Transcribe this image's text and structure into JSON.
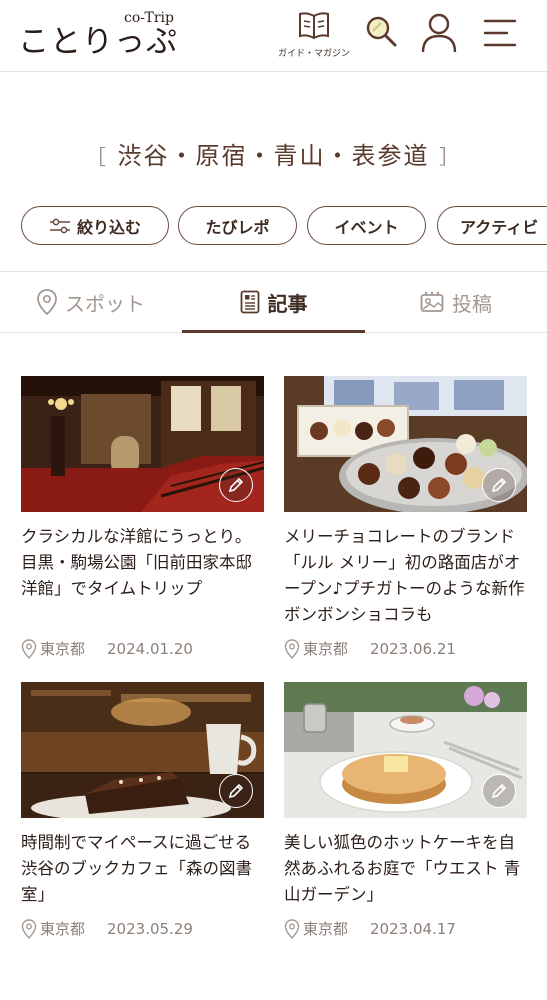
{
  "header": {
    "logo_main": "ことりっぷ",
    "logo_sub": "co-Trip",
    "guide_label": "ガイド・マガジン"
  },
  "area": {
    "open_bracket": "［",
    "title": "渋谷・原宿・青山・表参道",
    "close_bracket": "］"
  },
  "chips": [
    {
      "label": "絞り込む",
      "icon": "filter-sliders-icon"
    },
    {
      "label": "たびレポ"
    },
    {
      "label": "イベント"
    },
    {
      "label": "アクティビ"
    }
  ],
  "tabs": [
    {
      "label": "スポット",
      "icon": "map-pin-icon",
      "active": false
    },
    {
      "label": "記事",
      "icon": "article-icon",
      "active": true
    },
    {
      "label": "投稿",
      "icon": "photo-post-icon",
      "active": false
    }
  ],
  "articles": [
    {
      "title": "クラシカルな洋館にうっとり。目黒・駒場公園「旧前田家本邸洋館」でタイムトリップ",
      "location": "東京都",
      "date": "2024.01.20",
      "badge_icon": "pencil-icon"
    },
    {
      "title": "メリーチョコレートのブランド「ルル メリー」初の路面店がオープン♪プチガトーのような新作ボンボンショコラも",
      "location": "東京都",
      "date": "2023.06.21",
      "badge_icon": "pencil-icon"
    },
    {
      "title": "時間制でマイペースに過ごせる渋谷のブックカフェ「森の図書室」",
      "location": "東京都",
      "date": "2023.05.29",
      "badge_icon": "pencil-icon"
    },
    {
      "title": "美しい狐色のホットケーキを自然あふれるお庭で「ウエスト 青山ガーデン」",
      "location": "東京都",
      "date": "2023.04.17",
      "badge_icon": "pencil-icon"
    }
  ],
  "colors": {
    "accent_brown": "#5a3a2c",
    "text_dark": "#2b1d17",
    "text_muted": "#8c7f78",
    "divider": "#e6e1dc"
  }
}
